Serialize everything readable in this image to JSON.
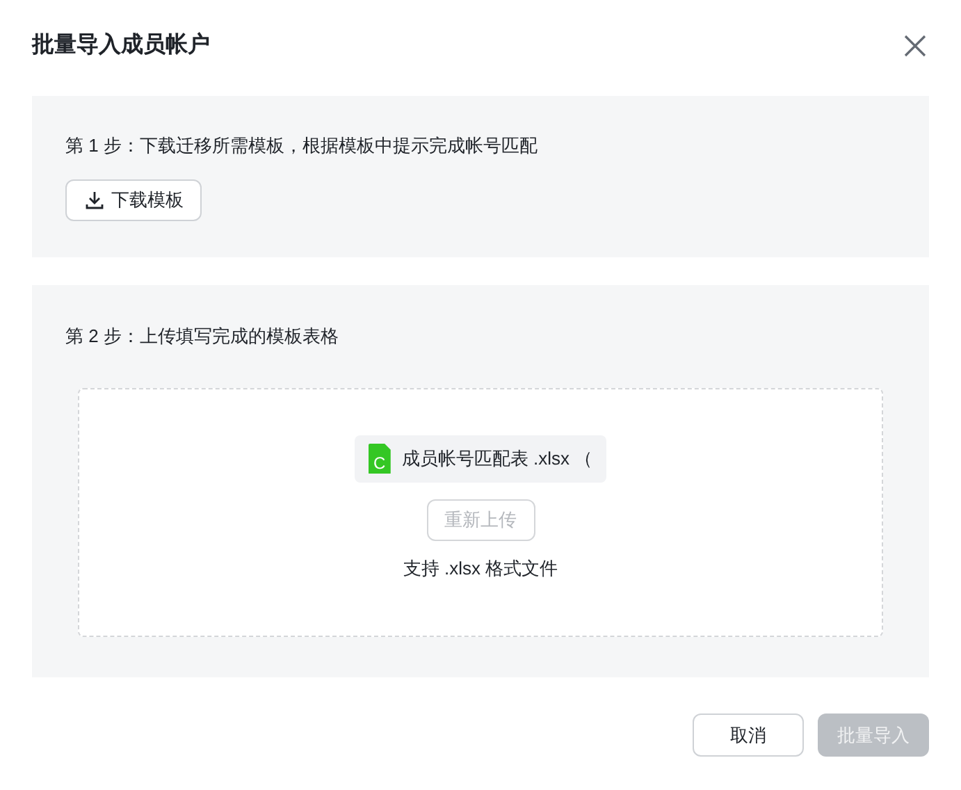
{
  "dialog": {
    "title": "批量导入成员帐户"
  },
  "steps": [
    {
      "title": "第 1 步：下载迁移所需模板，根据模板中提示完成帐号匹配",
      "kind": "download",
      "button": {
        "label": "下载模板",
        "disabled": false
      }
    },
    {
      "title": "第 2 步：上传填写完成的模板表格",
      "kind": "upload",
      "file": {
        "badge": "C",
        "name": "成员帐号匹配表 .xlsx （"
      },
      "button": {
        "label": "重新上传",
        "disabled": true
      },
      "hint": "支持 .xlsx 格式文件"
    }
  ],
  "footer": [
    {
      "label": "取消",
      "kind": "secondary",
      "disabled": false
    },
    {
      "label": "批量导入",
      "kind": "primary",
      "disabled": true
    }
  ]
}
